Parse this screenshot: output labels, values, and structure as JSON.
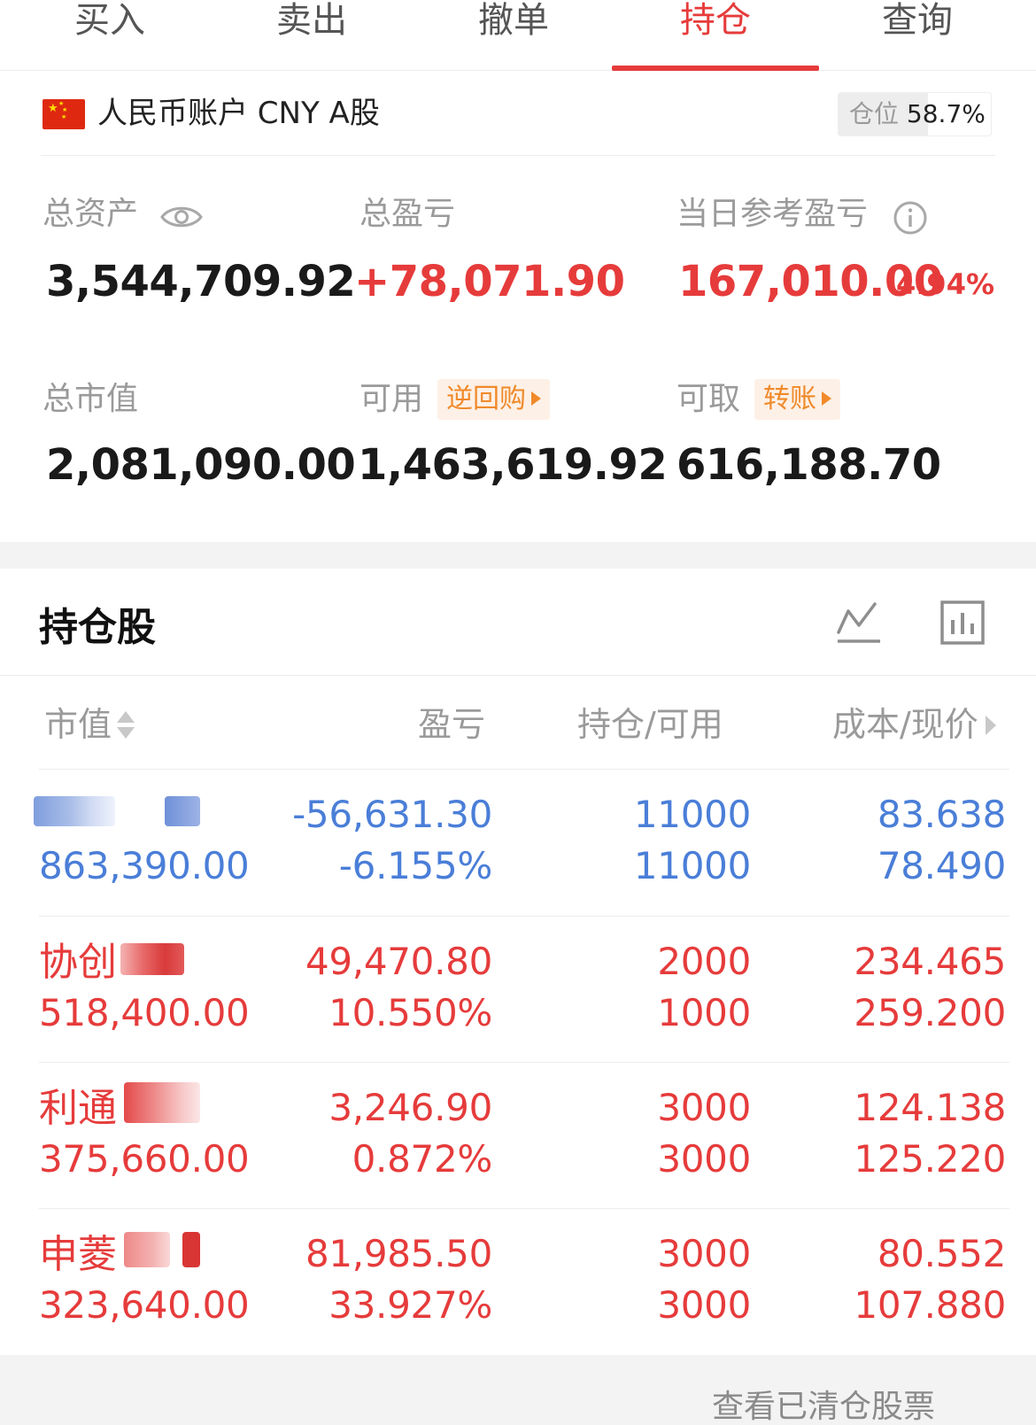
{
  "tabs": [
    {
      "label": "买入"
    },
    {
      "label": "卖出"
    },
    {
      "label": "撤单"
    },
    {
      "label": "持仓"
    },
    {
      "label": "查询"
    }
  ],
  "active_tab": "持仓",
  "account": {
    "name": "人民币账户 CNY A股",
    "position_label": "仓位",
    "position_value": "58.7%",
    "position_fraction": 0.587
  },
  "summary": {
    "total_assets_label": "总资产",
    "total_assets": "3,544,709.92",
    "total_pl_label": "总盈亏",
    "total_pl": "+78,071.90",
    "day_pl_label": "当日参考盈亏",
    "day_pl": "167,010.00",
    "day_pl_pct": "4.94%",
    "market_value_label": "总市值",
    "market_value": "2,081,090.00",
    "available_label": "可用",
    "available_tag": "逆回购",
    "available": "1,463,619.92",
    "withdrawable_label": "可取",
    "withdrawable_tag": "转账",
    "withdrawable": "616,188.70"
  },
  "holdings": {
    "title": "持仓股",
    "columns": {
      "market_value": "市值",
      "pl": "盈亏",
      "position": "持仓/可用",
      "cost_price": "成本/现价"
    },
    "rows": [
      {
        "name": "",
        "market_value": "863,390.00",
        "pl": "-56,631.30",
        "pl_pct": "-6.155%",
        "position": "11000",
        "available": "11000",
        "cost": "83.638",
        "price": "78.490",
        "tone": "blue"
      },
      {
        "name": "协创",
        "market_value": "518,400.00",
        "pl": "49,470.80",
        "pl_pct": "10.550%",
        "position": "2000",
        "available": "1000",
        "cost": "234.465",
        "price": "259.200",
        "tone": "red"
      },
      {
        "name": "利通",
        "market_value": "375,660.00",
        "pl": "3,246.90",
        "pl_pct": "0.872%",
        "position": "3000",
        "available": "3000",
        "cost": "124.138",
        "price": "125.220",
        "tone": "red"
      },
      {
        "name": "申菱",
        "market_value": "323,640.00",
        "pl": "81,985.50",
        "pl_pct": "33.927%",
        "position": "3000",
        "available": "3000",
        "cost": "80.552",
        "price": "107.880",
        "tone": "red"
      }
    ]
  },
  "footer": {
    "link": "查看已清仓股票"
  },
  "colors": {
    "accent_red": "#e63b3b",
    "loss_blue": "#4a7ed8",
    "tag_orange": "#f08a2a"
  }
}
